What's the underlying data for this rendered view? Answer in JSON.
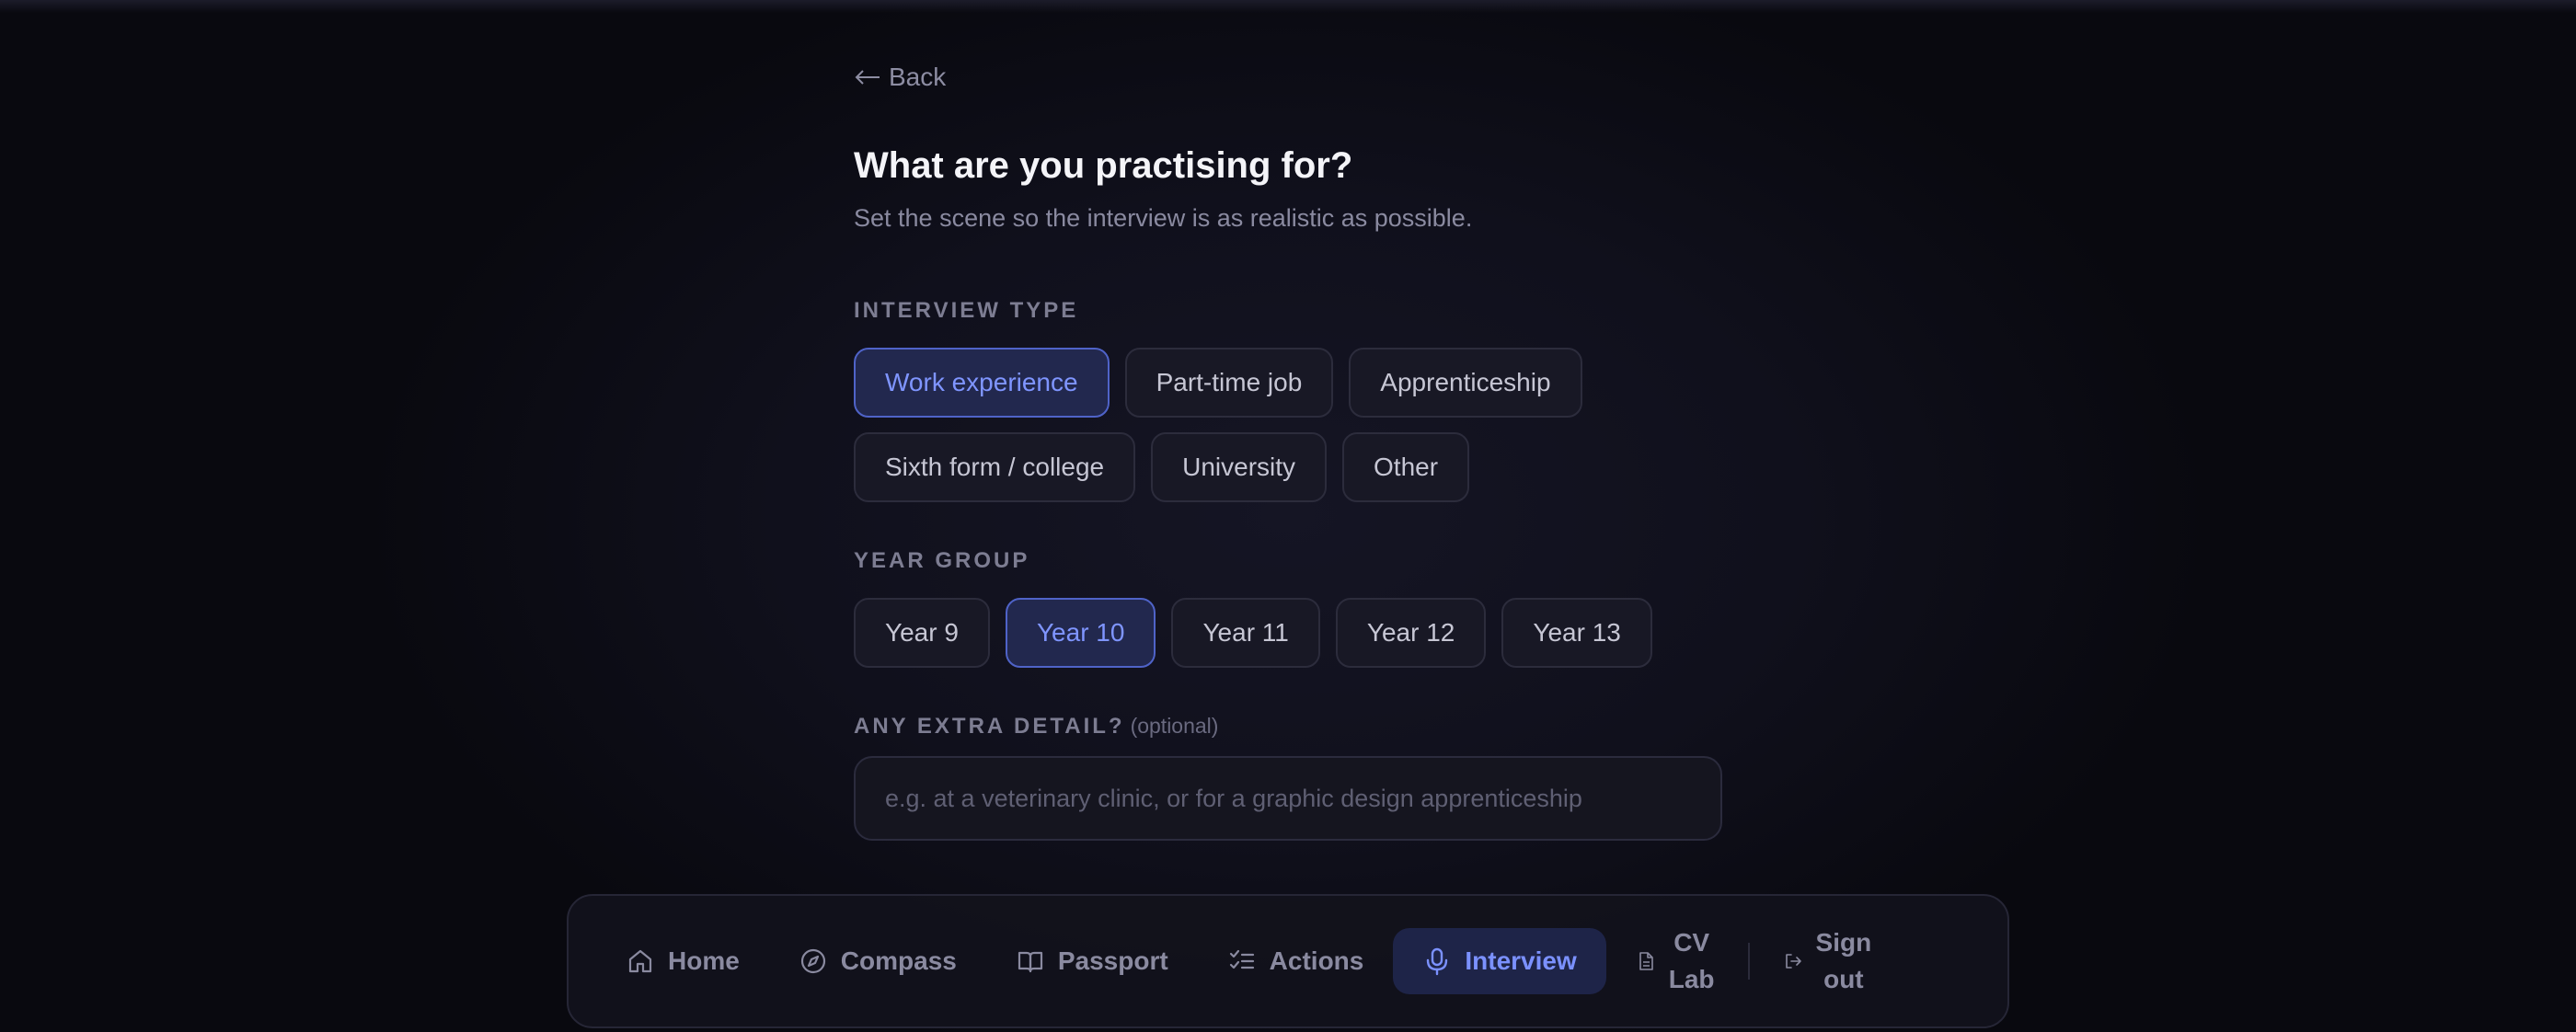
{
  "back": {
    "label": "Back"
  },
  "header": {
    "title": "What are you practising for?",
    "subtitle": "Set the scene so the interview is as realistic as possible."
  },
  "interview_type": {
    "label": "INTERVIEW TYPE",
    "selected": "Work experience",
    "options": [
      "Work experience",
      "Part-time job",
      "Apprenticeship",
      "Sixth form / college",
      "University",
      "Other"
    ]
  },
  "year_group": {
    "label": "YEAR GROUP",
    "selected": "Year 10",
    "options": [
      "Year 9",
      "Year 10",
      "Year 11",
      "Year 12",
      "Year 13"
    ]
  },
  "extra_detail": {
    "label": "ANY EXTRA DETAIL?",
    "optional_label": "(optional)",
    "value": "",
    "placeholder": "e.g. at a veterinary clinic, or for a graphic design apprenticeship"
  },
  "nav": {
    "active": "Interview",
    "items": [
      {
        "label": "Home",
        "icon": "home-icon"
      },
      {
        "label": "Compass",
        "icon": "compass-icon"
      },
      {
        "label": "Passport",
        "icon": "book-icon"
      },
      {
        "label": "Actions",
        "icon": "checklist-icon"
      },
      {
        "label": "Interview",
        "icon": "microphone-icon"
      },
      {
        "label_line1": "CV",
        "label_line2": "Lab",
        "icon": "document-icon"
      }
    ],
    "sign_out": {
      "label_line1": "Sign",
      "label_line2": "out",
      "icon": "sign-out-icon"
    }
  },
  "colors": {
    "background": "#0b0b14",
    "accent": "#7b91ff",
    "selected_chip_bg": "#22284e",
    "selected_chip_border": "#4f63c8"
  }
}
